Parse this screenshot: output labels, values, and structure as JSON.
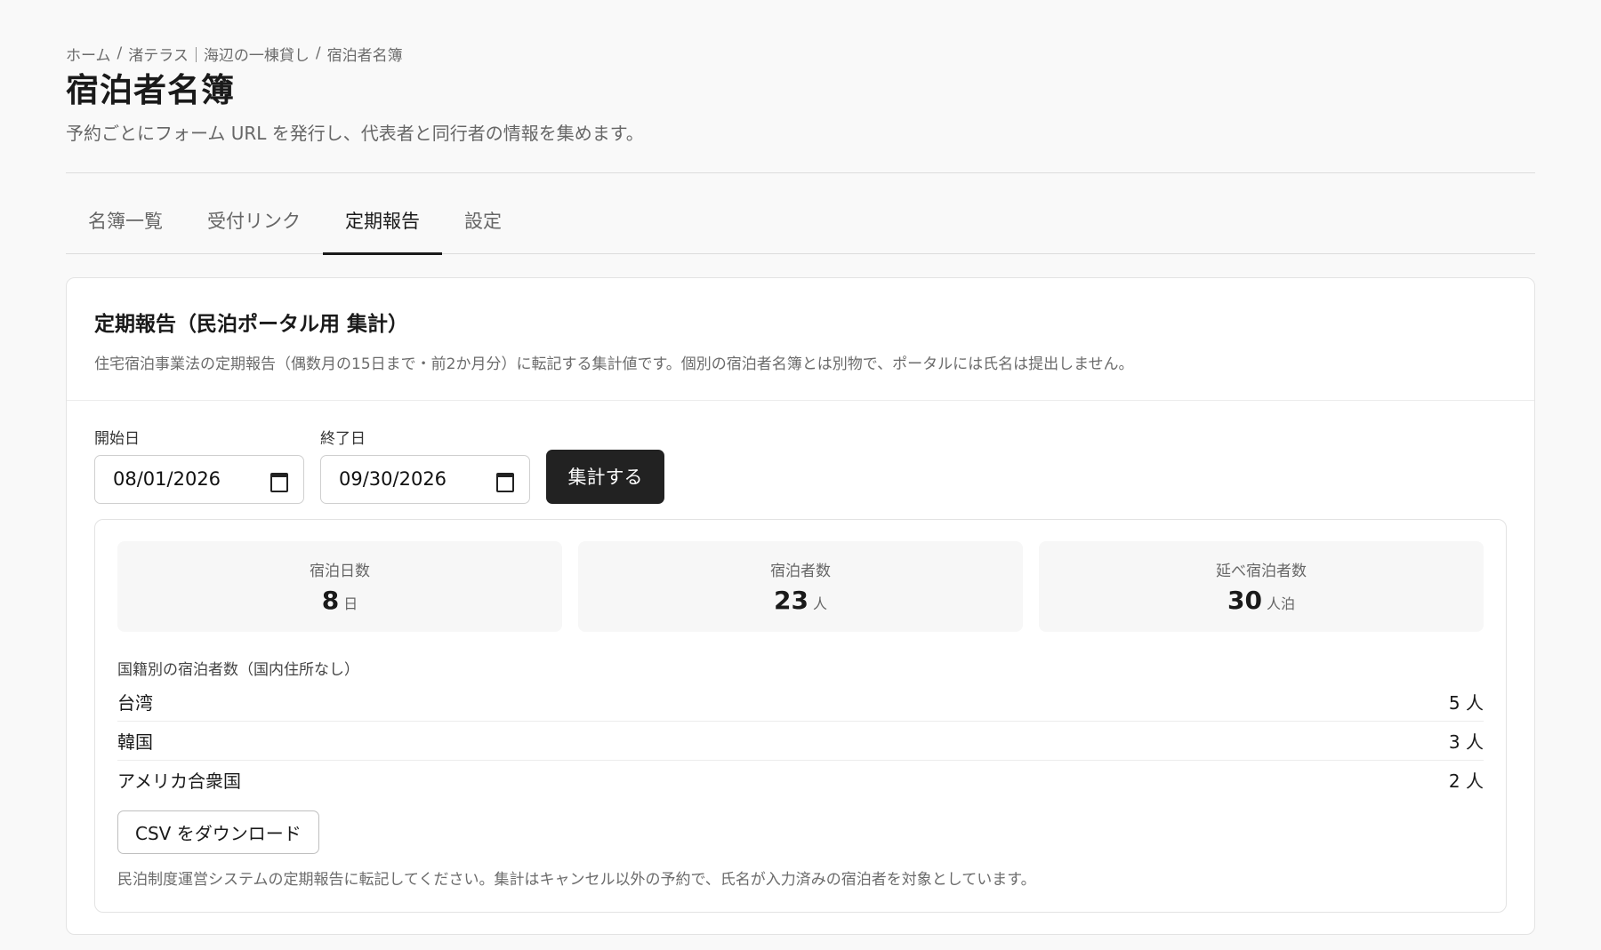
{
  "breadcrumb": {
    "items": [
      "ホーム",
      "渚テラス｜海辺の一棟貸し",
      "宿泊者名簿"
    ],
    "separator": "/"
  },
  "page": {
    "title": "宿泊者名簿",
    "description": "予約ごとにフォーム URL を発行し、代表者と同行者の情報を集めます。"
  },
  "tabs": [
    {
      "label": "名簿一覧",
      "active": false
    },
    {
      "label": "受付リンク",
      "active": false
    },
    {
      "label": "定期報告",
      "active": true
    },
    {
      "label": "設定",
      "active": false
    }
  ],
  "report": {
    "title": "定期報告（民泊ポータル用 集計）",
    "description": "住宅宿泊事業法の定期報告（偶数月の15日まで・前2か月分）に転記する集計値です。個別の宿泊者名簿とは別物で、ポータルには氏名は提出しません。",
    "start_label": "開始日",
    "start_value": "08/01/2026",
    "end_label": "終了日",
    "end_value": "09/30/2026",
    "submit_label": "集計する"
  },
  "stats": [
    {
      "label": "宿泊日数",
      "value": "8",
      "unit": "日"
    },
    {
      "label": "宿泊者数",
      "value": "23",
      "unit": "人"
    },
    {
      "label": "延べ宿泊者数",
      "value": "30",
      "unit": "人泊"
    }
  ],
  "nationality": {
    "title": "国籍別の宿泊者数（国内住所なし）",
    "rows": [
      {
        "country": "台湾",
        "count": "5 人"
      },
      {
        "country": "韓国",
        "count": "3 人"
      },
      {
        "country": "アメリカ合衆国",
        "count": "2 人"
      }
    ]
  },
  "csv_button_label": "CSV をダウンロード",
  "footer_note": "民泊制度運営システムの定期報告に転記してください。集計はキャンセル以外の予約で、氏名が入力済みの宿泊者を対象としています。",
  "colors": {
    "background": "#f9f9f9",
    "primary_button": "#222222",
    "card": "#ffffff"
  },
  "icons": {
    "date_picker": "calendar-icon"
  }
}
